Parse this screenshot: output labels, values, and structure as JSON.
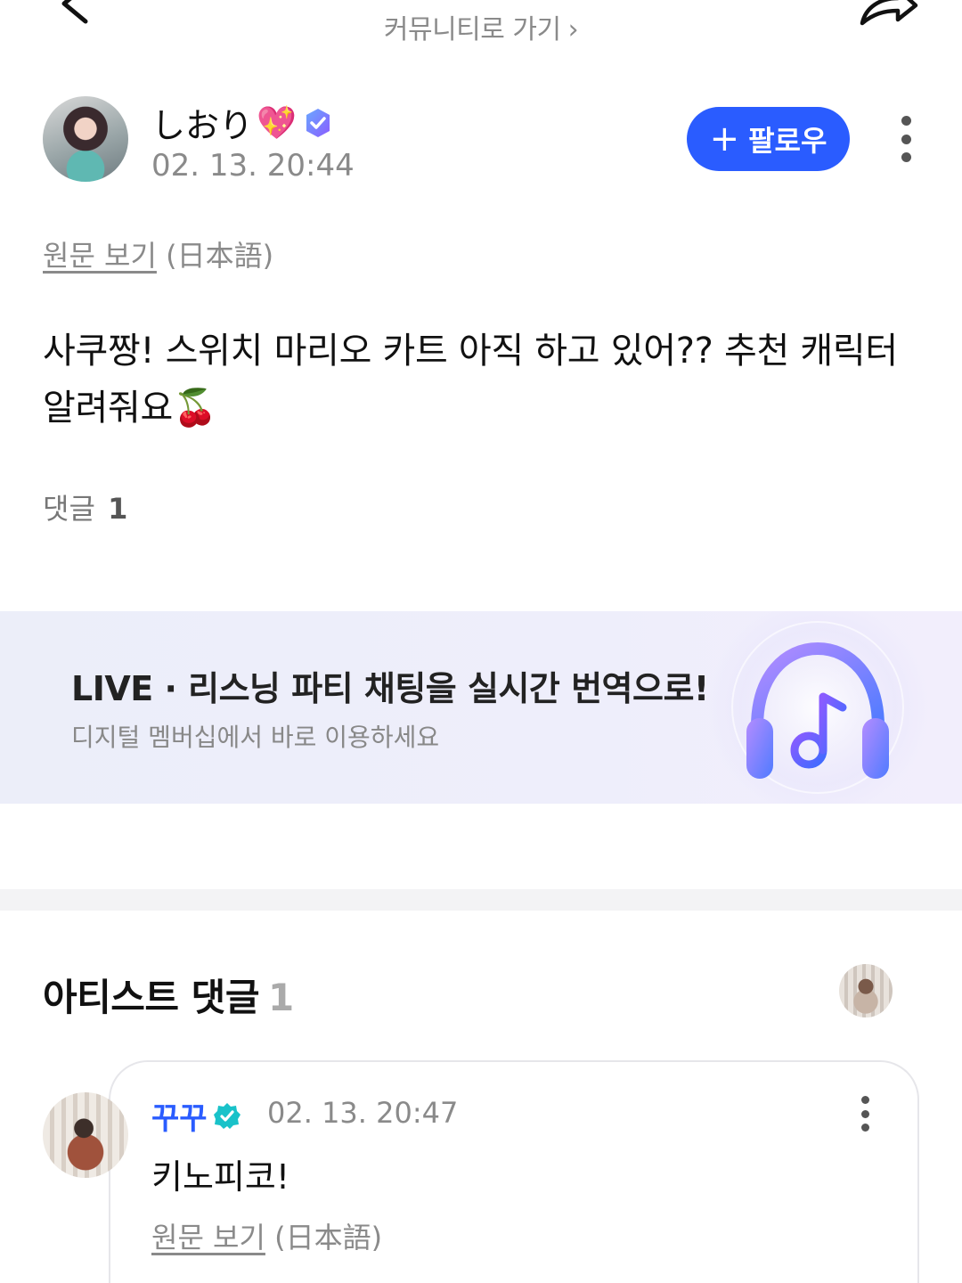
{
  "top_bar": {
    "community_link_label": "커뮤니티로 가기",
    "community_link_chevron": "›",
    "back_icon": "chevron-left-icon",
    "share_icon": "share-icon"
  },
  "post": {
    "author_name": "しおり",
    "author_emoji": "💖",
    "timestamp": "02. 13. 20:44",
    "follow_label": "팔로우",
    "follow_plus": "+",
    "original_link_label": "원문 보기",
    "original_language": "(日本語)",
    "body": "사쿠짱! 스위치 마리오 카트 아직 하고 있어?? 추천 캐릭터 알려줘요🍒",
    "comment_label": "댓글",
    "comment_count": "1"
  },
  "banner": {
    "title": "LIVE · 리스닝 파티 채팅을 실시간 번역으로!",
    "subtitle": "디지털 멤버십에서 바로 이용하세요",
    "icon": "headphones-music-icon"
  },
  "artist_comments": {
    "title": "아티스트 댓글",
    "count": "1",
    "items": [
      {
        "author": "꾸꾸",
        "timestamp": "02. 13. 20:47",
        "text": "키노피코!",
        "original_link_label": "원문 보기",
        "original_language": "(日本語)"
      }
    ]
  },
  "colors": {
    "accent_blue": "#2a5cff",
    "muted_text": "#8a8a8a",
    "banner_bg": "#eceef9",
    "verified_teal": "#19c2c9"
  }
}
